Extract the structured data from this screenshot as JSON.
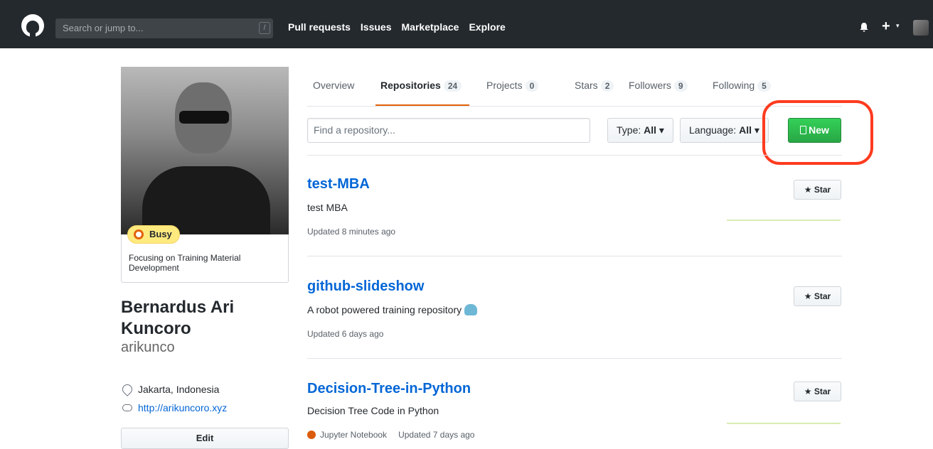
{
  "header": {
    "search_placeholder": "Search or jump to...",
    "search_shortcut": "/",
    "nav": [
      "Pull requests",
      "Issues",
      "Marketplace",
      "Explore"
    ],
    "plus": "+",
    "caret": "▾"
  },
  "profile": {
    "status_badge": "Busy",
    "status_message": "Focusing on Training Material Development",
    "full_name": "Bernardus Ari Kuncoro",
    "username": "arikunco",
    "location": "Jakarta, Indonesia",
    "website": "http://arikuncoro.xyz",
    "edit_label": "Edit"
  },
  "tabs": [
    {
      "label": "Overview",
      "count": ""
    },
    {
      "label": "Repositories",
      "count": "24"
    },
    {
      "label": "Projects",
      "count": "0"
    },
    {
      "label": "Stars",
      "count": "2"
    },
    {
      "label": "Followers",
      "count": "9"
    },
    {
      "label": "Following",
      "count": "5"
    }
  ],
  "filters": {
    "find_placeholder": "Find a repository...",
    "type_label": "Type:",
    "type_value": "All",
    "language_label": "Language:",
    "language_value": "All",
    "new_label": "New"
  },
  "repos": [
    {
      "name": "test-MBA",
      "description": "test MBA",
      "language": "",
      "updated": "Updated 8 minutes ago",
      "star_label": "Star"
    },
    {
      "name": "github-slideshow",
      "description": "A robot powered training repository",
      "language": "",
      "updated": "Updated 6 days ago",
      "star_label": "Star"
    },
    {
      "name": "Decision-Tree-in-Python",
      "description": "Decision Tree Code in Python",
      "language": "Jupyter Notebook",
      "updated": "Updated 7 days ago",
      "star_label": "Star"
    }
  ],
  "colors": {
    "header_bg": "#24292e",
    "link": "#0366d6",
    "new_button": "#28a745",
    "tab_underline": "#e36209",
    "highlight_ring": "#ff3b1f",
    "jupyter": "#DA5B0B"
  }
}
